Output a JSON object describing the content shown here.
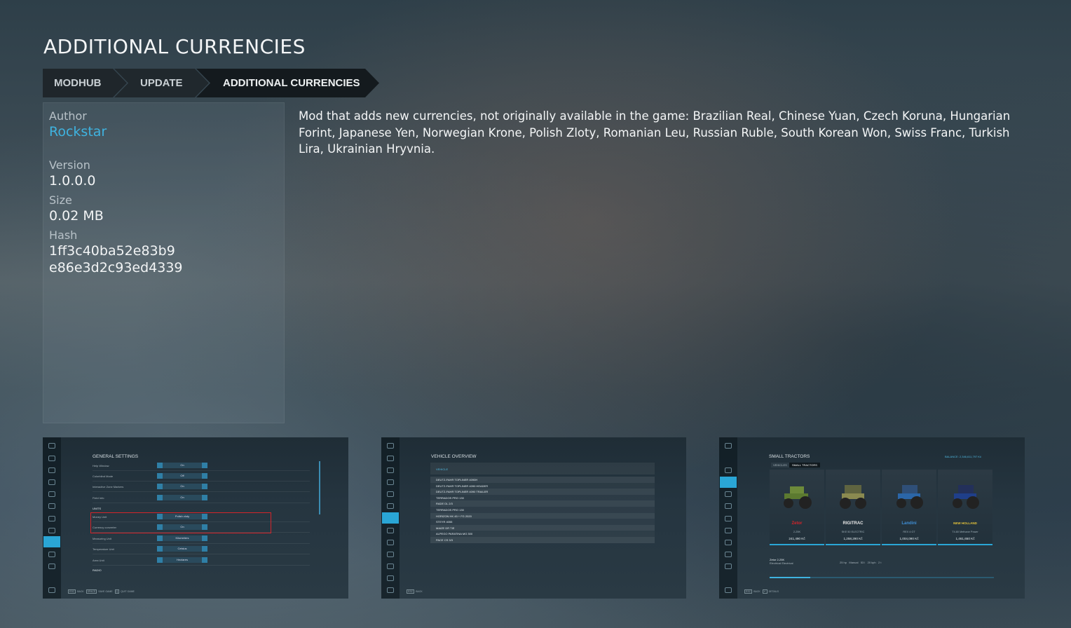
{
  "page": {
    "title": "ADDITIONAL CURRENCIES"
  },
  "breadcrumb": [
    {
      "label": "MODHUB"
    },
    {
      "label": "UPDATE"
    },
    {
      "label": "ADDITIONAL CURRENCIES"
    }
  ],
  "info": {
    "author_label": "Author",
    "author_value": "Rockstar",
    "version_label": "Version",
    "version_value": "1.0.0.0",
    "size_label": "Size",
    "size_value": "0.02 MB",
    "hash_label": "Hash",
    "hash_line1": "1ff3c40ba52e83b9",
    "hash_line2": "e86e3d2c93ed4339"
  },
  "description": "Mod that adds new currencies, not originally available in the game: Brazilian Real, Chinese Yuan, Czech Koruna, Hungarian Forint, Japanese Yen, Norwegian Krone, Polish Zloty, Romanian Leu, Russian Ruble, South Korean Won, Swiss Franc, Turkish Lira, Ukrainian Hryvnia.",
  "screenshots": {
    "general_settings": {
      "title": "GENERAL SETTINGS",
      "section_units": "UNITS",
      "section_radio": "RADIO",
      "rows": [
        {
          "label": "Help Window",
          "value": "On"
        },
        {
          "label": "Colorblind Mode",
          "value": "Off"
        },
        {
          "label": "Interactive Zone Markers",
          "value": "On"
        },
        {
          "label": "Field Info",
          "value": "On"
        },
        {
          "label": "Money Unit",
          "value": "Polish zloty"
        },
        {
          "label": "Currency converter",
          "value": "On"
        },
        {
          "label": "Measuring Unit",
          "value": "Kilometers"
        },
        {
          "label": "Temperature Unit",
          "value": "Celsius"
        },
        {
          "label": "Area Unit",
          "value": "Hectares"
        }
      ],
      "hints": [
        "BACK",
        "SAVE GAME",
        "QUIT GAME"
      ]
    },
    "vehicle_overview": {
      "title": "VEHICLE OVERVIEW",
      "column": "VEHICLE",
      "rows": [
        "DEUTZ-FAHR TOPLINER 4090H",
        "DEUTZ-FAHR TOPLINER 4090 HEADER",
        "DEUTZ-FAHR TOPLINER 4090 TRAILER",
        "TERRADOS PRO 130",
        "RADE DL 2/3",
        "TERRADOS PRO 130",
        "HORIZON HK 45 + FG 2020",
        "STEYR 4055",
        "MAIZE DR TIE",
        "ALPEGO PARATINA MG 300",
        "PACE CS 3/3"
      ],
      "hints": [
        "BACK"
      ]
    },
    "small_tractors": {
      "title": "SMALL TRACTORS",
      "balance": "BALANCE: 2,346,611,797 Kč",
      "tabs": [
        "VEHICLES",
        "SMALL TRACTORS"
      ],
      "cards": [
        {
          "brand": "Zetor",
          "model": "2-25K",
          "price": "241,490 Kč",
          "color": "#d4242a"
        },
        {
          "brand": "RIGITRAC",
          "model": "SKE 50 ELECTRIC",
          "price": "1,258,290 Kč",
          "color": "#e8e8e8"
        },
        {
          "brand": "Landini",
          "model": "REX 4 GT",
          "price": "1,004,090 Kč",
          "color": "#3f8fd6"
        },
        {
          "brand": "NEW HOLLAND",
          "model": "T4.80 Methane Power",
          "price": "1,461,650 Kč",
          "color": "#e8c53a"
        }
      ],
      "selected_name": "Zetor 2-25K",
      "selected_sub": "Electrical Electrical",
      "specs": [
        "25 hp",
        "Manual",
        "53 l",
        "20 kph",
        "2 t"
      ],
      "hints": [
        "BACK",
        "DETAILS"
      ]
    }
  }
}
